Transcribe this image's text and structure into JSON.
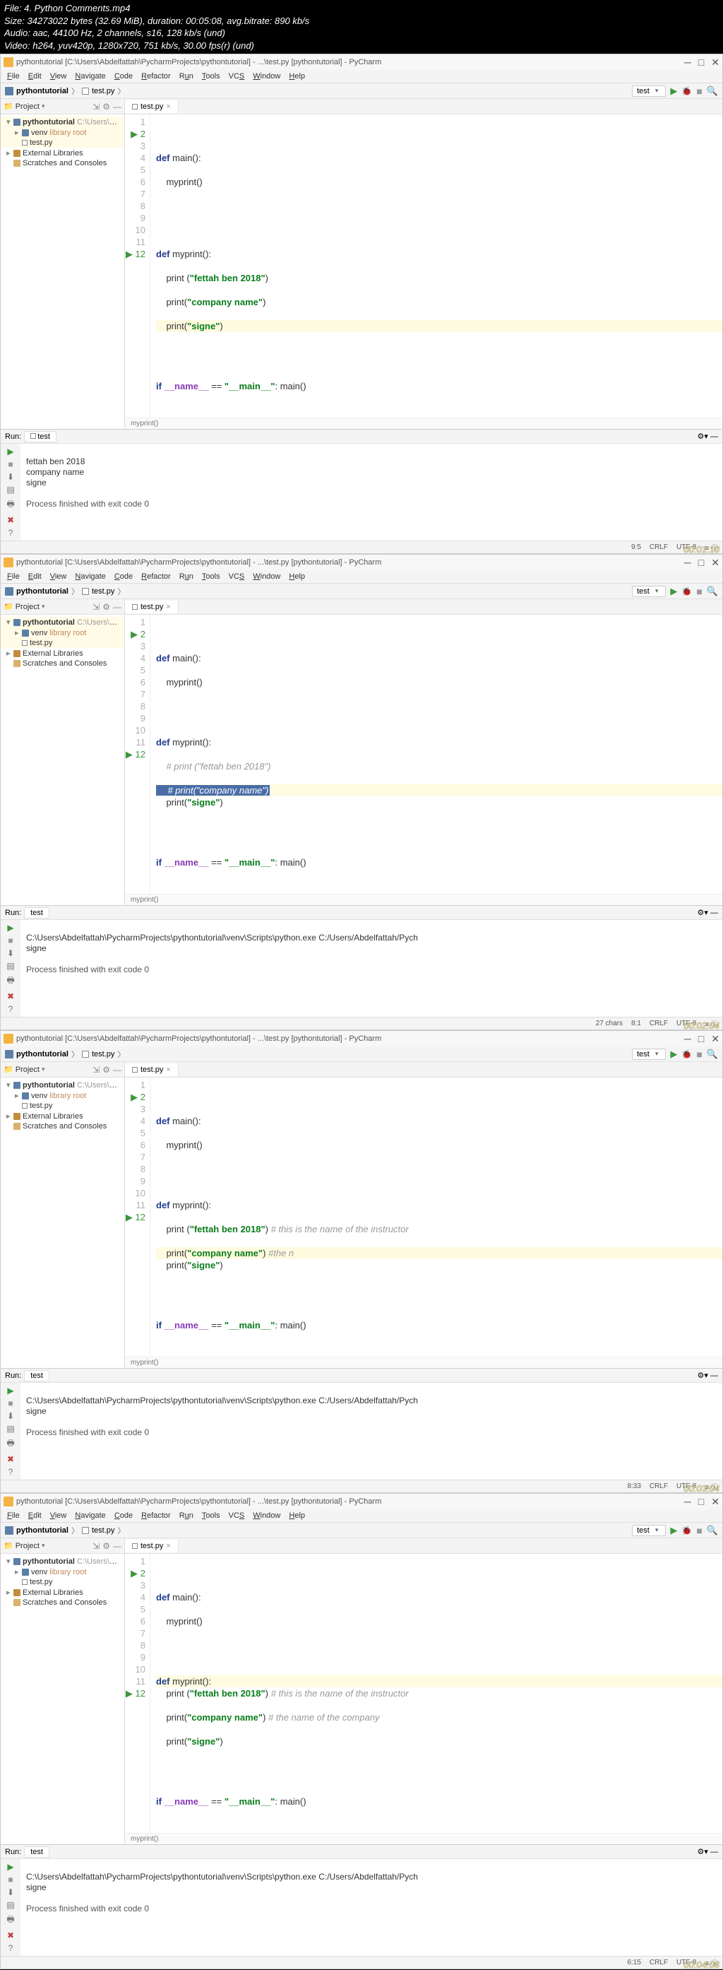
{
  "video": {
    "file": "File: 4. Python Comments.mp4",
    "size": "Size: 34273022 bytes (32.69 MiB), duration: 00:05:08, avg.bitrate: 890 kb/s",
    "audio": "Audio: aac, 44100 Hz, 2 channels, s16, 128 kb/s (und)",
    "video": "Video: h264, yuv420p, 1280x720, 751 kb/s, 30.00 fps(r) (und)"
  },
  "common": {
    "title": "pythontutorial [C:\\Users\\Abdelfattah\\PycharmProjects\\pythontutorial] - ...\\test.py [pythontutorial] - PyCharm",
    "project_root": "pythontutorial",
    "project_path": "C:\\Users\\Abdelfattah\\PycharmProjects",
    "venv": "venv",
    "venv_lib": "library root",
    "testpy": "test.py",
    "ext_lib": "External Libraries",
    "scratches": "Scratches and Consoles",
    "run_config": "test",
    "project_label": "Project",
    "run_label": "Run:",
    "editor_tab": "test.py",
    "breadcrumb_func": "myprint()",
    "menu": {
      "file": "File",
      "edit": "Edit",
      "view": "View",
      "navigate": "Navigate",
      "code": "Code",
      "refactor": "Refactor",
      "run": "Run",
      "tools": "Tools",
      "vcs": "VCS",
      "window": "Window",
      "help": "Help"
    }
  },
  "frame1": {
    "lines": {
      "l1": "",
      "l2_a": "def ",
      "l2_b": "main():",
      "l3": "    myprint()",
      "l4": "",
      "l5": "",
      "l6_a": "def ",
      "l6_b": "myprint():",
      "l7_a": "    print (",
      "l7_b": "\"fettah ben 2018\"",
      "l7_c": ")",
      "l8_a": "    print(",
      "l8_b": "\"company name\"",
      "l8_c": ")",
      "l9_a": "    print(",
      "l9_b": "\"signe\"",
      "l9_c": ")",
      "l10": "",
      "l11": "",
      "l12_a": "if ",
      "l12_b": "__name__",
      "l12_c": " == ",
      "l12_d": "\"__main__\"",
      "l12_e": ": main()"
    },
    "output": {
      "l1": "fettah ben 2018",
      "l2": "company name",
      "l3": "signe",
      "l4": "",
      "l5": "Process finished with exit code 0"
    },
    "status": {
      "pos": "9:5",
      "crlf": "CRLF",
      "enc": "UTF-8",
      "time": "00:01:10"
    }
  },
  "frame2": {
    "lines": {
      "l1": "",
      "l2_a": "def ",
      "l2_b": "main():",
      "l3": "    myprint()",
      "l4": "",
      "l5": "",
      "l6_a": "def ",
      "l6_b": "myprint():",
      "l7_c": "    # print (\"fettah ben 2018\")",
      "l8_c": "    # print(\"company name\")",
      "l9_a": "    print(",
      "l9_b": "\"signe\"",
      "l9_c": ")",
      "l10": "",
      "l11": "",
      "l12_a": "if ",
      "l12_b": "__name__",
      "l12_c": " == ",
      "l12_d": "\"__main__\"",
      "l12_e": ": main()"
    },
    "output": {
      "l1": "C:\\Users\\Abdelfattah\\PycharmProjects\\pythontutorial\\venv\\Scripts\\python.exe C:/Users/Abdelfattah/Pych",
      "l2": "signe",
      "l3": "",
      "l4": "Process finished with exit code 0"
    },
    "status": {
      "chars": "27 chars",
      "pos": "8:1",
      "crlf": "CRLF",
      "enc": "UTF-8",
      "time": "00:02:04"
    }
  },
  "frame3": {
    "lines": {
      "l1": "",
      "l2_a": "def ",
      "l2_b": "main():",
      "l3": "    myprint()",
      "l4": "",
      "l5": "",
      "l6_a": "def ",
      "l6_b": "myprint():",
      "l7_a": "    print (",
      "l7_b": "\"fettah ben 2018\"",
      "l7_c": ") ",
      "l7_d": "# this is the name of the instructor",
      "l8_a": "    print(",
      "l8_b": "\"company name\"",
      "l8_c": ") ",
      "l8_d": "#the n",
      "l9_a": "    print(",
      "l9_b": "\"signe\"",
      "l9_c": ")",
      "l10": "",
      "l11": "",
      "l12_a": "if ",
      "l12_b": "__name__",
      "l12_c": " == ",
      "l12_d": "\"__main__\"",
      "l12_e": ": main()"
    },
    "output": {
      "l1": "C:\\Users\\Abdelfattah\\PycharmProjects\\pythontutorial\\venv\\Scripts\\python.exe C:/Users/Abdelfattah/Pych",
      "l2": "signe",
      "l3": "",
      "l4": "Process finished with exit code 0"
    },
    "status": {
      "pos": "8:33",
      "crlf": "CRLF",
      "enc": "UTF-8",
      "time": "00:03:04"
    }
  },
  "frame4": {
    "lines": {
      "l1": "",
      "l2_a": "def ",
      "l2_b": "main():",
      "l3": "    myprint()",
      "l4": "",
      "l5": "",
      "l6_a": "def ",
      "l6_b": "myprint():",
      "l7_a": "    print (",
      "l7_b": "\"fettah ben 2018\"",
      "l7_c": ") ",
      "l7_d": "# this is the name of the instructor",
      "l8_a": "    print(",
      "l8_b": "\"company name\"",
      "l8_c": ") ",
      "l8_d": "# the name of the company",
      "l9_a": "    print(",
      "l9_b": "\"signe\"",
      "l9_c": ")",
      "l10": "",
      "l11": "",
      "l12_a": "if ",
      "l12_b": "__name__",
      "l12_c": " == ",
      "l12_d": "\"__main__\"",
      "l12_e": ": main()"
    },
    "output": {
      "l1": "C:\\Users\\Abdelfattah\\PycharmProjects\\pythontutorial\\venv\\Scripts\\python.exe C:/Users/Abdelfattah/Pych",
      "l2": "signe",
      "l3": "",
      "l4": "Process finished with exit code 0"
    },
    "status": {
      "pos": "6:15",
      "crlf": "CRLF",
      "enc": "UTF-8",
      "time": "00:04:06"
    }
  }
}
